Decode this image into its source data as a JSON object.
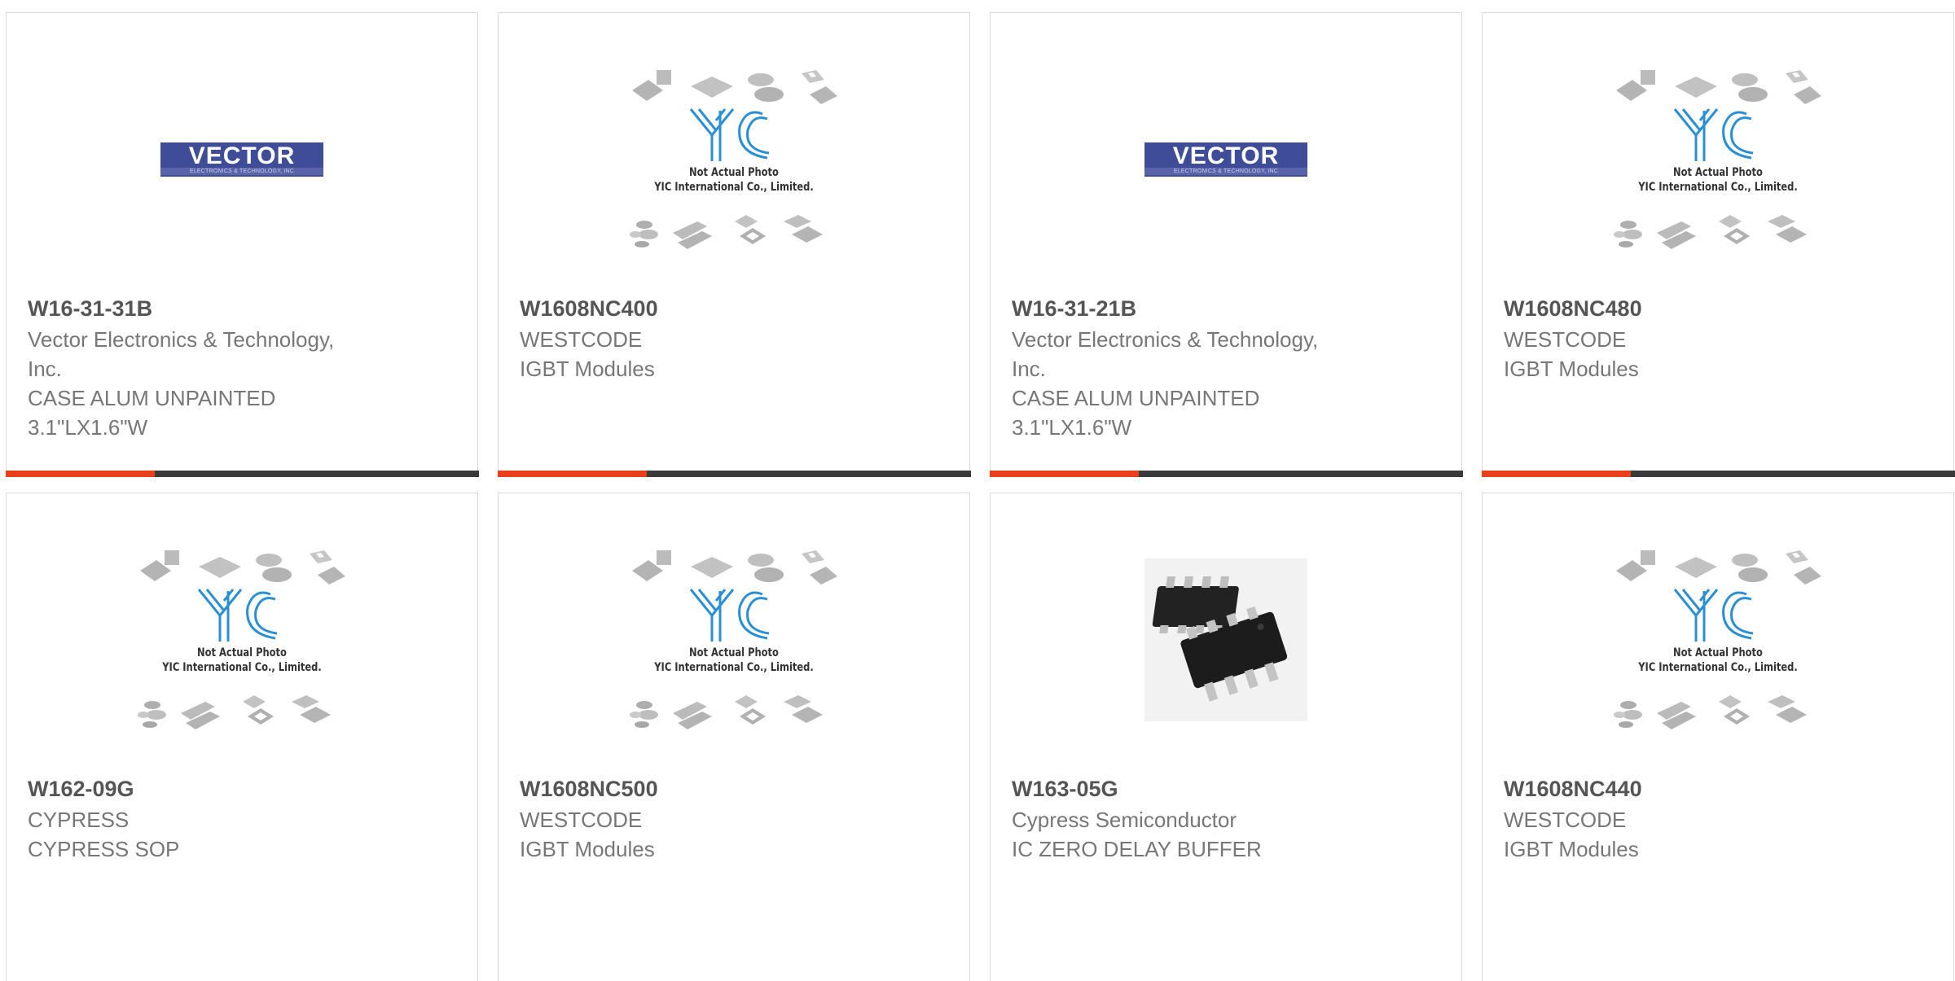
{
  "colors": {
    "accent": "#e8401c",
    "bar": "#3a3a3a",
    "card_border": "#d9d9d9",
    "part_text": "#555555",
    "body_text": "#777777",
    "yic_blue": "#2a8fd4"
  },
  "placeholder": {
    "line1": "Not Actual Photo",
    "line2": "YIC International Co., Limited.",
    "logo_text": "YIC"
  },
  "vector_logo": {
    "name": "VECTOR",
    "tagline": "ELECTRONICS & TECHNOLOGY, INC"
  },
  "products": [
    {
      "image": "vector-logo",
      "part_number": "W16-31-31B",
      "manufacturer_line1": "Vector Electronics & Technology,",
      "manufacturer_line2": "Inc.",
      "description_line1": "CASE ALUM UNPAINTED",
      "description_line2": "3.1\"LX1.6\"W"
    },
    {
      "image": "yic-placeholder",
      "part_number": "W1608NC400",
      "manufacturer_line1": "WESTCODE",
      "description_line1": "IGBT Modules"
    },
    {
      "image": "vector-logo",
      "part_number": "W16-31-21B",
      "manufacturer_line1": "Vector Electronics & Technology,",
      "manufacturer_line2": "Inc.",
      "description_line1": "CASE ALUM UNPAINTED",
      "description_line2": "3.1\"LX1.6\"W"
    },
    {
      "image": "yic-placeholder",
      "part_number": "W1608NC480",
      "manufacturer_line1": "WESTCODE",
      "description_line1": "IGBT Modules"
    },
    {
      "image": "yic-placeholder",
      "part_number": "W162-09G",
      "manufacturer_line1": "CYPRESS",
      "description_line1": "CYPRESS SOP"
    },
    {
      "image": "yic-placeholder",
      "part_number": "W1608NC500",
      "manufacturer_line1": "WESTCODE",
      "description_line1": "IGBT Modules"
    },
    {
      "image": "soic-chip-photo",
      "part_number": "W163-05G",
      "manufacturer_line1": "Cypress Semiconductor",
      "description_line1": "IC ZERO DELAY BUFFER"
    },
    {
      "image": "yic-placeholder",
      "part_number": "W1608NC440",
      "manufacturer_line1": "WESTCODE",
      "description_line1": "IGBT Modules"
    }
  ]
}
